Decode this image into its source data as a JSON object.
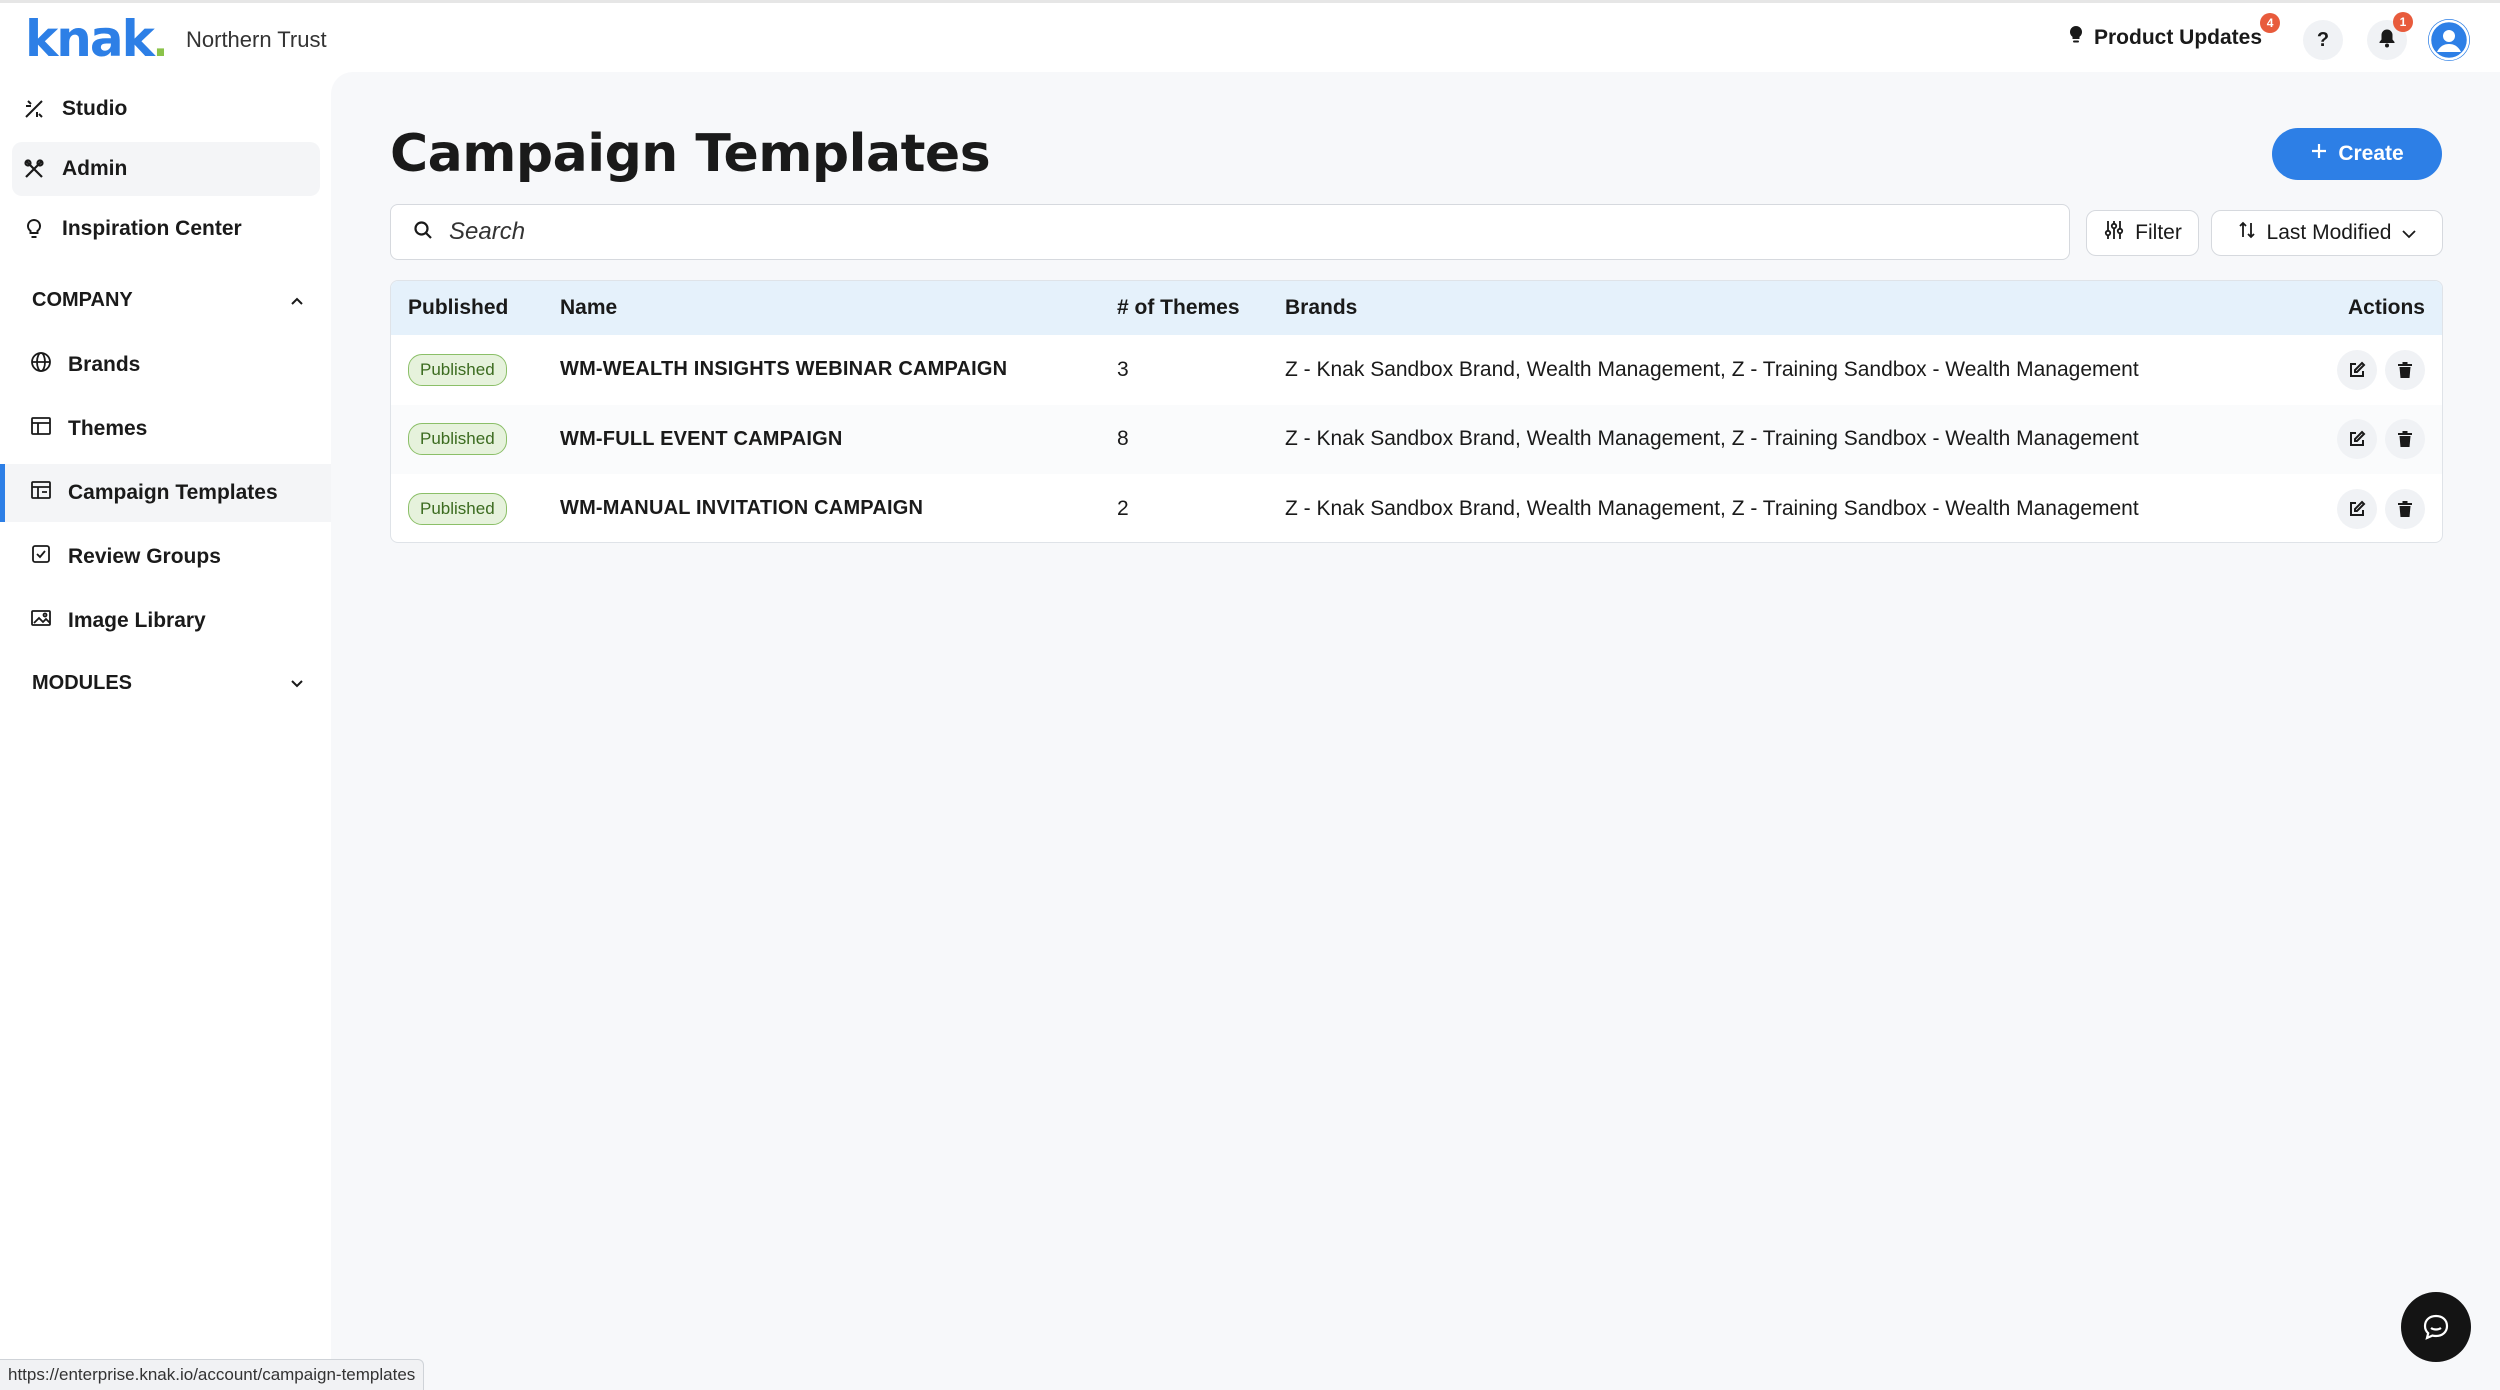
{
  "header": {
    "logo": "knak",
    "org_name": "Northern Trust",
    "product_updates_label": "Product Updates",
    "product_updates_count": "4",
    "help_label": "?",
    "notifications_count": "1"
  },
  "sidebar": {
    "nav": [
      {
        "label": "Studio",
        "icon": "studio-icon"
      },
      {
        "label": "Admin",
        "icon": "admin-tools-icon"
      },
      {
        "label": "Inspiration Center",
        "icon": "lightbulb-icon"
      }
    ],
    "company_section": "COMPANY",
    "company_items": [
      {
        "label": "Brands",
        "icon": "globe-icon"
      },
      {
        "label": "Themes",
        "icon": "themes-icon"
      },
      {
        "label": "Campaign Templates",
        "icon": "campaign-icon"
      },
      {
        "label": "Review Groups",
        "icon": "checkbox-icon"
      },
      {
        "label": "Image Library",
        "icon": "image-icon"
      }
    ],
    "modules_section": "MODULES"
  },
  "main": {
    "title": "Campaign Templates",
    "create_label": "Create",
    "search_placeholder": "Search",
    "filter_label": "Filter",
    "sort_label": "Last Modified",
    "table": {
      "headers": [
        "Published",
        "Name",
        "# of Themes",
        "Brands",
        "Actions"
      ],
      "rows": [
        {
          "status": "Published",
          "name": "WM-WEALTH INSIGHTS WEBINAR CAMPAIGN",
          "themes": "3",
          "brands": "Z - Knak Sandbox Brand, Wealth Management, Z - Training Sandbox - Wealth Management"
        },
        {
          "status": "Published",
          "name": "WM-FULL EVENT CAMPAIGN",
          "themes": "8",
          "brands": "Z - Knak Sandbox Brand, Wealth Management, Z - Training Sandbox - Wealth Management"
        },
        {
          "status": "Published",
          "name": "WM-MANUAL INVITATION CAMPAIGN",
          "themes": "2",
          "brands": "Z - Knak Sandbox Brand, Wealth Management, Z - Training Sandbox - Wealth Management"
        }
      ]
    }
  },
  "status_url": "https://enterprise.knak.io/account/campaign-templates",
  "colors": {
    "brand_blue": "#2d7fe6",
    "published_green": "#8bbf68",
    "header_row": "#e5f1fb",
    "badge_red": "#e85b3c"
  }
}
